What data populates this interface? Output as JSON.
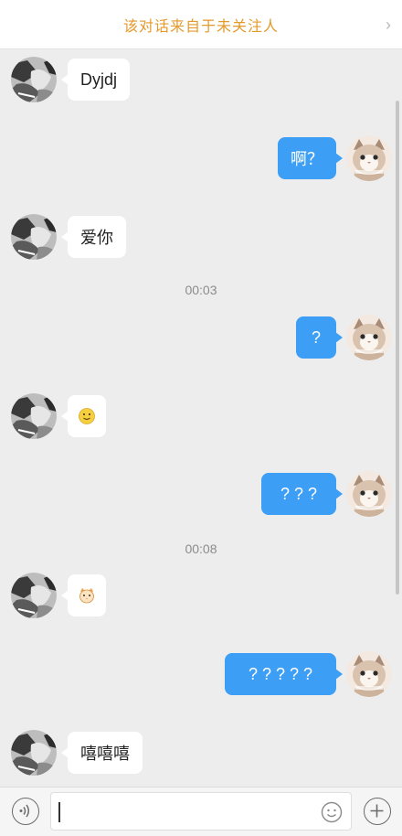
{
  "banner": {
    "text": "该对话来自于未关注人",
    "chevron_icon": "chevron-right-icon"
  },
  "contact_avatar": "contact-avatar-bw-photo",
  "my_avatar": "cat-avatar",
  "messages": [
    {
      "from": "them",
      "text": "Dyjdj"
    },
    {
      "from": "me",
      "text": "啊？"
    },
    {
      "from": "them",
      "text": "爱你"
    },
    {
      "time": "00:03"
    },
    {
      "from": "me",
      "text": "?"
    },
    {
      "from": "them",
      "icon": "smile-emoji-icon"
    },
    {
      "from": "me",
      "text": "? ? ?"
    },
    {
      "time": "00:08"
    },
    {
      "from": "them",
      "icon": "cat-face-emoji-icon"
    },
    {
      "from": "me",
      "text": "? ? ? ? ?"
    },
    {
      "from": "them",
      "text": "嘻嘻嘻"
    }
  ],
  "input_bar": {
    "voice_icon": "voice-icon",
    "input_value": "",
    "emoji_icon": "emoji-face-icon",
    "plus_icon": "plus-icon"
  },
  "colors": {
    "outgoing_bubble": "#3c9ef5",
    "incoming_bubble": "#ffffff",
    "banner_text": "#e49a2c",
    "chat_background": "#ededed"
  }
}
